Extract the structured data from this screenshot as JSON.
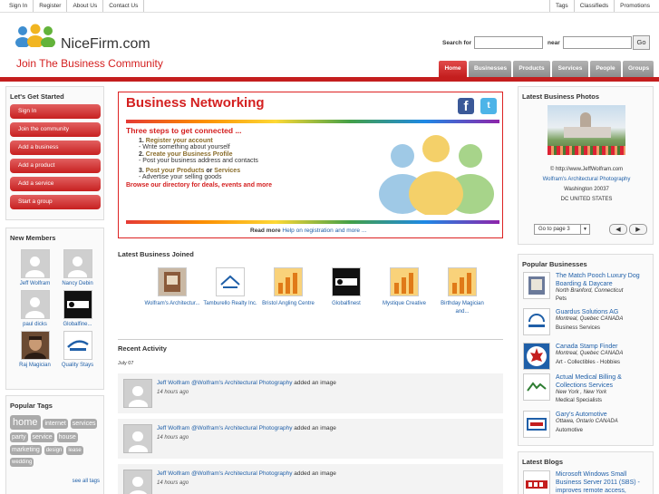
{
  "topbar": {
    "left": [
      "Sign In",
      "Register",
      "About Us",
      "Contact Us"
    ],
    "right": [
      "Tags",
      "Classifieds",
      "Promotions"
    ]
  },
  "header": {
    "logo_text": "NiceFirm.com",
    "tagline": "Join The Business Community",
    "search_for_label": "Search for",
    "search_for_value": "",
    "near_label": "near",
    "near_value": "",
    "go_label": "Go",
    "tabs": [
      "Home",
      "Businesses",
      "Products",
      "Services",
      "People",
      "Groups"
    ],
    "active_tab": "Home"
  },
  "left": {
    "started_title": "Let's Get Started",
    "started_buttons": [
      "Sign In",
      "Join the community",
      "Add a business",
      "Add a product",
      "Add a service",
      "Start a group"
    ],
    "members_title": "New Members",
    "members": [
      "Jeff Wolfram",
      "Nancy Debin",
      "paul dicks",
      "Globalfine...",
      "Raj Magician",
      "Quality Stays"
    ],
    "tags_title": "Popular Tags",
    "tags": [
      "home",
      "internet",
      "services",
      "party",
      "service",
      "house",
      "marketing",
      "design",
      "lease",
      "wedding"
    ],
    "see_all_tags": "see all tags"
  },
  "center": {
    "hero_title": "Business Networking",
    "steps_heading": "Three steps to get connected ...",
    "step1_num": "1.",
    "step1_link": "Register your account",
    "step1_desc": "- Write something about yourself",
    "step2_num": "2.",
    "step2_link": "Create your Business Profile",
    "step2_desc": "- Post your business address and contacts",
    "step3_num": "3.",
    "step3_link_a": "Post your Products",
    "step3_or": "or",
    "step3_link_b": "Services",
    "step3_desc": "- Advertise your selling goods",
    "browse_text": "Browse our directory for deals, events and more",
    "read_more_label": "Read more",
    "read_more_link": "Help on registration and more ...",
    "latest_joined_title": "Latest Business Joined",
    "latest_joined": [
      {
        "name": "Wolfram's Architectur...",
        "thumb": "photo"
      },
      {
        "name": "Tamburello Realty Inc.",
        "thumb": "logo"
      },
      {
        "name": "Bristol Angling Centre",
        "thumb": "graph"
      },
      {
        "name": "Globalfinest",
        "thumb": "dark"
      },
      {
        "name": "Mystique Creative",
        "thumb": "graph"
      },
      {
        "name": "Birthday Magician and...",
        "thumb": "graph"
      }
    ],
    "activity_title": "Recent Activity",
    "activity_date": "July 07",
    "activities": [
      {
        "user": "Jeff Wolfram",
        "target": "@Wolfram's Architectural Photography",
        "action": "added an image",
        "time": "14 hours ago"
      },
      {
        "user": "Jeff Wolfram",
        "target": "@Wolfram's Architectural Photography",
        "action": "added an image",
        "time": "14 hours ago"
      },
      {
        "user": "Jeff Wolfram",
        "target": "@Wolfram's Architectural Photography",
        "action": "added an image",
        "time": "14 hours ago"
      }
    ]
  },
  "right": {
    "photos_title": "Latest Business Photos",
    "photo_credit": "© http://www.JeffWolfram.com",
    "photo_business": "Wolfram's Architectural Photography",
    "photo_city": "Washington 20037",
    "photo_region": "DC UNITED STATES",
    "pager_label": "Go to page 3",
    "popular_title": "Popular Businesses",
    "popular": [
      {
        "name": "The Match Pooch Luxury Dog Boarding & Daycare",
        "location": "North Branford, Connecticut",
        "category": "Pets"
      },
      {
        "name": "Guardus Solutions AG",
        "location": "Montreal, Quebec CANADA",
        "category": "Business Services"
      },
      {
        "name": "Canada Stamp Finder",
        "location": "Montreal, Quebec CANADA",
        "category": "Art - Collectibles - Hobbies"
      },
      {
        "name": "Actual Medical Billing & Collections Services",
        "location": "New York , New York",
        "category": "Medical Specialists"
      },
      {
        "name": "Gary's Automotive",
        "location": "Ottawa, Ontario CANADA",
        "category": "Automotive"
      }
    ],
    "blogs_title": "Latest Blogs",
    "blog_title": "Microsoft Windows Small Business Server 2011 (SBS) - improves remote access, deployment"
  }
}
